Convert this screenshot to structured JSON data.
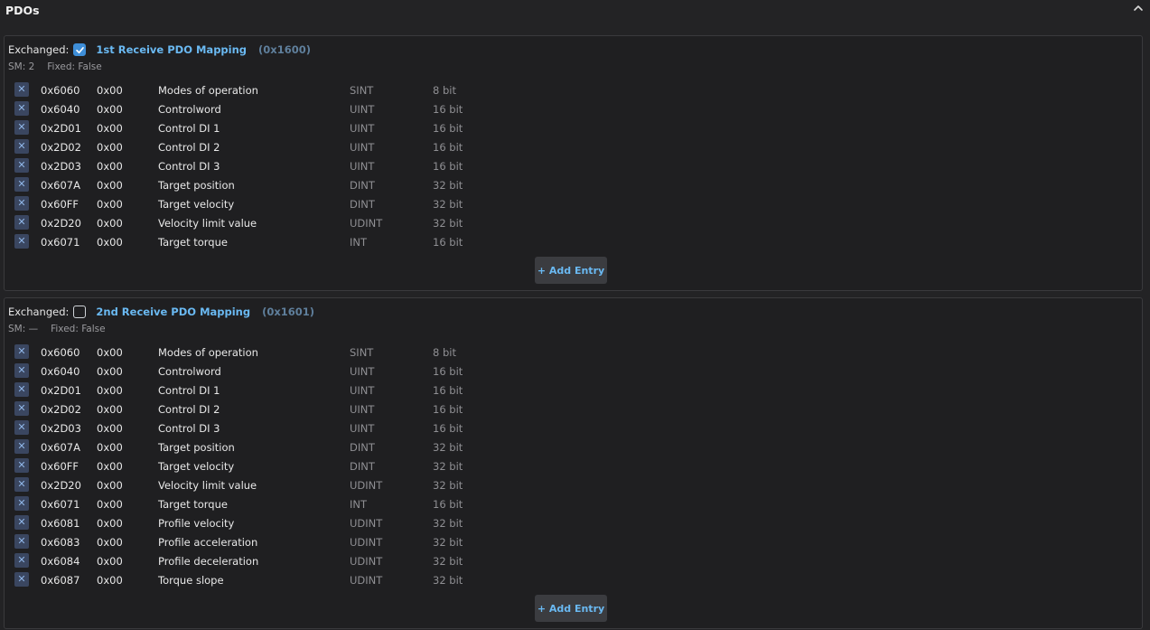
{
  "header": {
    "title": "PDOs"
  },
  "pdos": [
    {
      "exchanged_label": "Exchanged:",
      "checked": true,
      "name": "1st Receive PDO Mapping",
      "index": "(0x1600)",
      "sm": "SM: 2",
      "fixed": "Fixed: False",
      "add_label": "+ Add Entry",
      "entries": [
        {
          "idx": "0x6060",
          "sub": "0x00",
          "name": "Modes of operation",
          "type": "SINT",
          "bits": "8 bit"
        },
        {
          "idx": "0x6040",
          "sub": "0x00",
          "name": "Controlword",
          "type": "UINT",
          "bits": "16 bit"
        },
        {
          "idx": "0x2D01",
          "sub": "0x00",
          "name": "Control DI 1",
          "type": "UINT",
          "bits": "16 bit"
        },
        {
          "idx": "0x2D02",
          "sub": "0x00",
          "name": "Control DI 2",
          "type": "UINT",
          "bits": "16 bit"
        },
        {
          "idx": "0x2D03",
          "sub": "0x00",
          "name": "Control DI 3",
          "type": "UINT",
          "bits": "16 bit"
        },
        {
          "idx": "0x607A",
          "sub": "0x00",
          "name": "Target position",
          "type": "DINT",
          "bits": "32 bit"
        },
        {
          "idx": "0x60FF",
          "sub": "0x00",
          "name": "Target velocity",
          "type": "DINT",
          "bits": "32 bit"
        },
        {
          "idx": "0x2D20",
          "sub": "0x00",
          "name": "Velocity limit value",
          "type": "UDINT",
          "bits": "32 bit"
        },
        {
          "idx": "0x6071",
          "sub": "0x00",
          "name": "Target torque",
          "type": "INT",
          "bits": "16 bit"
        }
      ]
    },
    {
      "exchanged_label": "Exchanged:",
      "checked": false,
      "name": "2nd Receive PDO Mapping",
      "index": "(0x1601)",
      "sm": "SM: —",
      "fixed": "Fixed: False",
      "add_label": "+ Add Entry",
      "entries": [
        {
          "idx": "0x6060",
          "sub": "0x00",
          "name": "Modes of operation",
          "type": "SINT",
          "bits": "8 bit"
        },
        {
          "idx": "0x6040",
          "sub": "0x00",
          "name": "Controlword",
          "type": "UINT",
          "bits": "16 bit"
        },
        {
          "idx": "0x2D01",
          "sub": "0x00",
          "name": "Control DI 1",
          "type": "UINT",
          "bits": "16 bit"
        },
        {
          "idx": "0x2D02",
          "sub": "0x00",
          "name": "Control DI 2",
          "type": "UINT",
          "bits": "16 bit"
        },
        {
          "idx": "0x2D03",
          "sub": "0x00",
          "name": "Control DI 3",
          "type": "UINT",
          "bits": "16 bit"
        },
        {
          "idx": "0x607A",
          "sub": "0x00",
          "name": "Target position",
          "type": "DINT",
          "bits": "32 bit"
        },
        {
          "idx": "0x60FF",
          "sub": "0x00",
          "name": "Target velocity",
          "type": "DINT",
          "bits": "32 bit"
        },
        {
          "idx": "0x2D20",
          "sub": "0x00",
          "name": "Velocity limit value",
          "type": "UDINT",
          "bits": "32 bit"
        },
        {
          "idx": "0x6071",
          "sub": "0x00",
          "name": "Target torque",
          "type": "INT",
          "bits": "16 bit"
        },
        {
          "idx": "0x6081",
          "sub": "0x00",
          "name": "Profile velocity",
          "type": "UDINT",
          "bits": "32 bit"
        },
        {
          "idx": "0x6083",
          "sub": "0x00",
          "name": "Profile acceleration",
          "type": "UDINT",
          "bits": "32 bit"
        },
        {
          "idx": "0x6084",
          "sub": "0x00",
          "name": "Profile deceleration",
          "type": "UDINT",
          "bits": "32 bit"
        },
        {
          "idx": "0x6087",
          "sub": "0x00",
          "name": "Torque slope",
          "type": "UDINT",
          "bits": "32 bit"
        }
      ]
    }
  ]
}
